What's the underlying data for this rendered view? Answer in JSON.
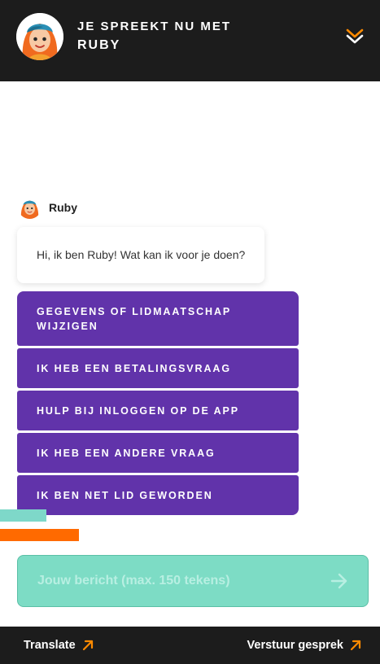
{
  "header": {
    "line1": "JE SPREEKT NU MET",
    "line2": "RUBY",
    "collapse_icon": "chevron-double-down-icon"
  },
  "colors": {
    "header_bg": "#1c1c1c",
    "accent": "#ff8a00",
    "option_bg": "#6133aa",
    "input_bg": "#7ddcc5",
    "deco_teal": "#7ed8c9",
    "deco_orange": "#ff6a00"
  },
  "agent": {
    "name": "Ruby",
    "avatar_icon": "ruby-avatar-icon"
  },
  "message": {
    "text": "Hi, ik ben Ruby! Wat kan ik voor je doen?"
  },
  "options": [
    {
      "label": "GEGEVENS OF LIDMAATSCHAP WIJZIGEN"
    },
    {
      "label": "IK HEB EEN BETALINGSVRAAG"
    },
    {
      "label": "HULP BIJ INLOGGEN OP DE APP"
    },
    {
      "label": "IK HEB EEN ANDERE VRAAG"
    },
    {
      "label": "IK BEN NET LID GEWORDEN"
    }
  ],
  "input": {
    "placeholder": "Jouw bericht (max. 150 tekens)",
    "value": "",
    "send_icon": "arrow-right-icon"
  },
  "footer": {
    "translate_label": "Translate",
    "send_conversation_label": "Verstuur gesprek",
    "link_icon": "arrow-up-right-icon"
  }
}
